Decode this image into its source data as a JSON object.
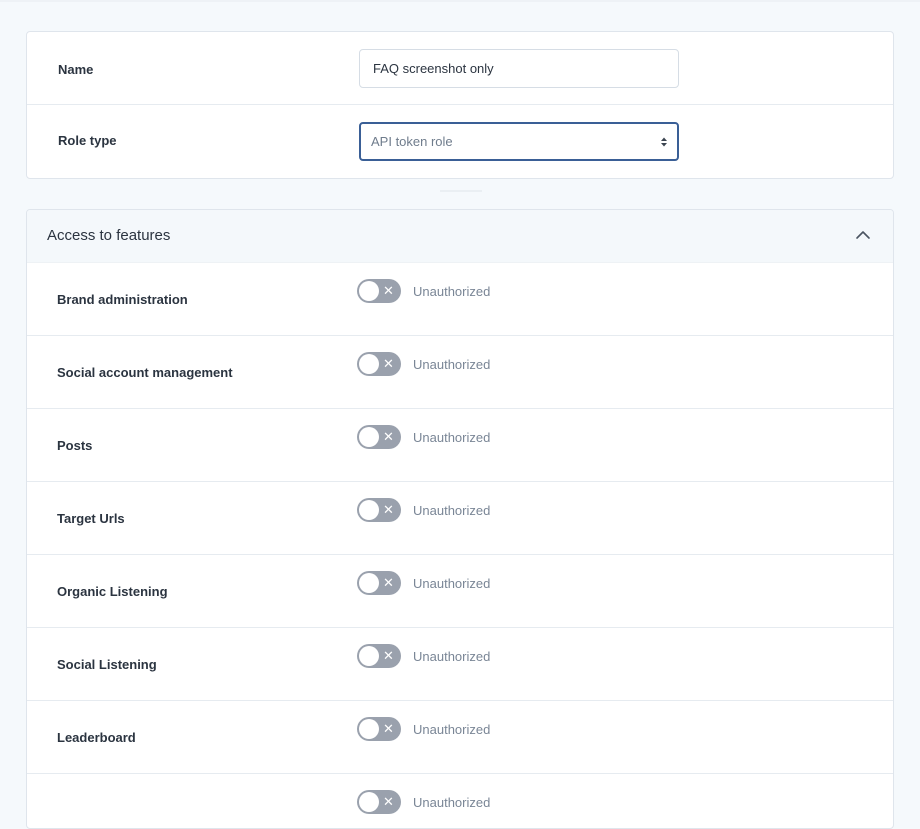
{
  "form": {
    "name_label": "Name",
    "name_value": "FAQ screenshot only",
    "role_type_label": "Role type",
    "role_type_value": "API token role"
  },
  "features": {
    "title": "Access to features",
    "chevron_icon": "chevron-up-icon",
    "toggle_icon": "x-icon",
    "items": [
      {
        "label": "Brand administration",
        "status": "Unauthorized",
        "enabled": false
      },
      {
        "label": "Social account management",
        "status": "Unauthorized",
        "enabled": false
      },
      {
        "label": "Posts",
        "status": "Unauthorized",
        "enabled": false
      },
      {
        "label": "Target Urls",
        "status": "Unauthorized",
        "enabled": false
      },
      {
        "label": "Organic Listening",
        "status": "Unauthorized",
        "enabled": false
      },
      {
        "label": "Social Listening",
        "status": "Unauthorized",
        "enabled": false
      },
      {
        "label": "Leaderboard",
        "status": "Unauthorized",
        "enabled": false
      },
      {
        "label": "",
        "status": "Unauthorized",
        "enabled": false
      }
    ]
  },
  "colors": {
    "focus_border": "#3a5f96",
    "toggle_off": "#9aa1ad"
  }
}
